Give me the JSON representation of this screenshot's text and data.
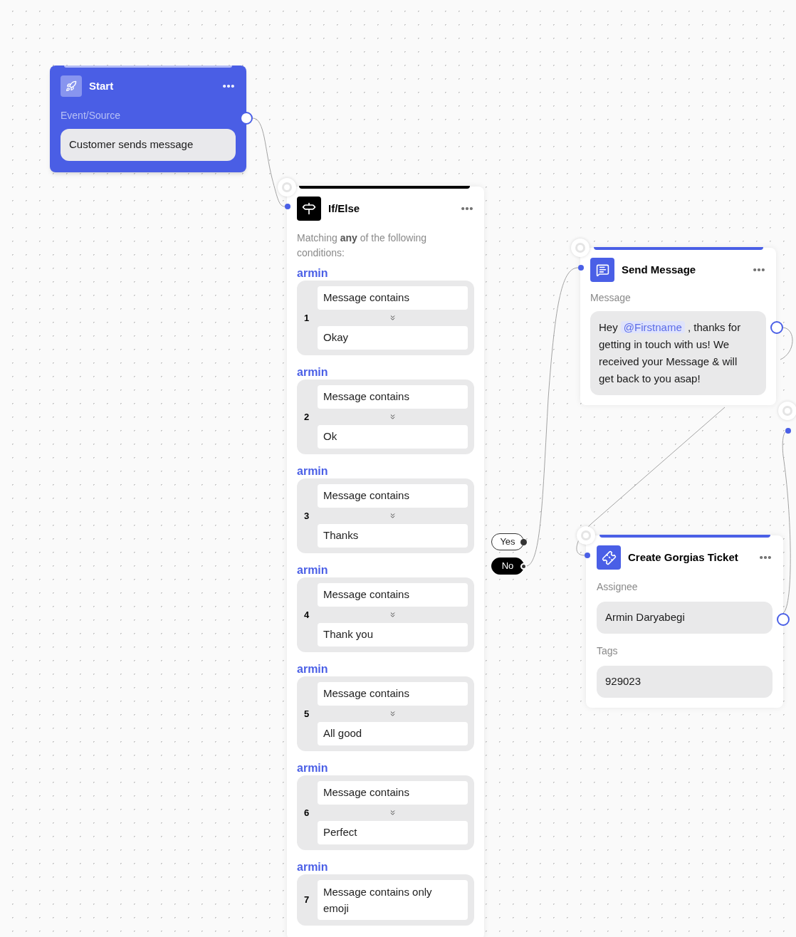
{
  "start": {
    "title": "Start",
    "field_label": "Event/Source",
    "field_value": "Customer sends message"
  },
  "if_else": {
    "title": "If/Else",
    "description": "Matching **any** of the following conditions:",
    "conditions": [
      {
        "kind": "pair",
        "group": "armin",
        "number": "1",
        "operator": "Message contains",
        "value": "Okay"
      },
      {
        "kind": "pair",
        "group": "armin",
        "number": "2",
        "operator": "Message contains",
        "value": "Ok"
      },
      {
        "kind": "pair",
        "group": "armin",
        "number": "3",
        "operator": "Message contains",
        "value": "Thanks"
      },
      {
        "kind": "pair",
        "group": "armin",
        "number": "4",
        "operator": "Message contains",
        "value": "Thank you"
      },
      {
        "kind": "pair",
        "group": "armin",
        "number": "5",
        "operator": "Message contains",
        "value": "All good"
      },
      {
        "kind": "pair",
        "group": "armin",
        "number": "6",
        "operator": "Message contains",
        "value": "Perfect"
      },
      {
        "kind": "single",
        "group": "armin",
        "number": "7",
        "operator": "Message contains only emoji"
      }
    ]
  },
  "branches": [
    {
      "label": "Yes",
      "selected": false
    },
    {
      "label": "No",
      "selected": true
    }
  ],
  "send_message": {
    "title": "Send Message",
    "field_label": "Message",
    "text_before": "Hey",
    "mention": "@Firstname",
    "text_after": ", thanks for getting in touch with us! We received your Message & will get back to you asap!"
  },
  "create_ticket": {
    "title": "Create Gorgias Ticket",
    "fields": [
      {
        "label": "Assignee",
        "value": "Armin Daryabegi"
      },
      {
        "label": "Tags",
        "value": "929023"
      }
    ]
  }
}
